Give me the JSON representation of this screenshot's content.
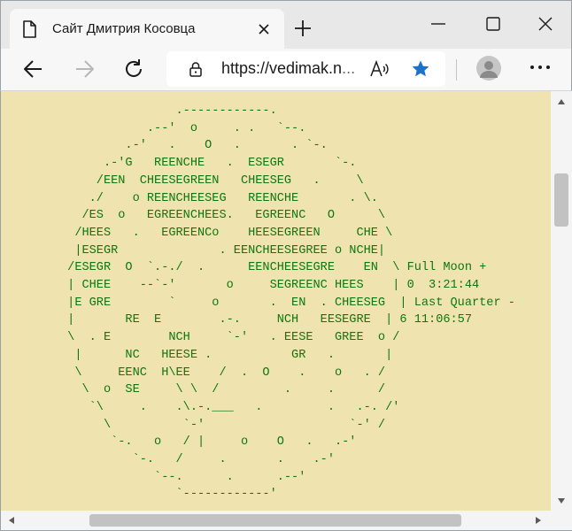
{
  "window": {
    "tab_title": "Сайт Дмитрия Косовца"
  },
  "toolbar": {
    "url_main": "https://vedimak.n",
    "url_dim": "..."
  },
  "page": {
    "moon_ascii_lines": [
      "                .------------.",
      "            .--'  o     . .   `--.",
      "         .-'   .    O   .       . `-.",
      "      .-'G   REENCHE   .  ESEGR       `-.",
      "     /EEN  CHEESEGREEN   CHEESEG   .     \\",
      "    ./    o REENCHEESEG   REENCHE       . \\.",
      "   /ES  o   EGREENCHEES.   EGREENC   O      \\",
      "  /HEES   .   EGREENCo    HEESEGREEN     CHE \\",
      "  |ESEGR              . EENCHEESEGREE o NCHE|",
      " /ESEGR  O  `.-./  .      EENCHEESEGRE    EN  \\ Full Moon +",
      " | CHEE    --`-'       o     SEGREENC HEES    | 0  3:21:44",
      " |E GRE        `     o       .  EN  . CHEESEG  | Last Quarter -",
      " |       RE  E        .-.     NCH   EESEGRE  | 6 11:06:57",
      " \\  . E        NCH     `-'   . EESE   GREE  o /",
      "  |      NC   HEESE .           GR   .       |",
      "  \\     EENC  H\\EE    /  .  O    .    o   . /",
      "   \\  o  SE     \\ \\  /         .     .      /",
      "    `\\     .    .\\.-.___   .         .   .-. /'",
      "      \\          `-'                    `-' /",
      "       `-.   o   / |     o    O   .   .-'",
      "          `-.   /     .       .    .-'",
      "             `--.      .      .--'",
      "                `------------'"
    ]
  }
}
